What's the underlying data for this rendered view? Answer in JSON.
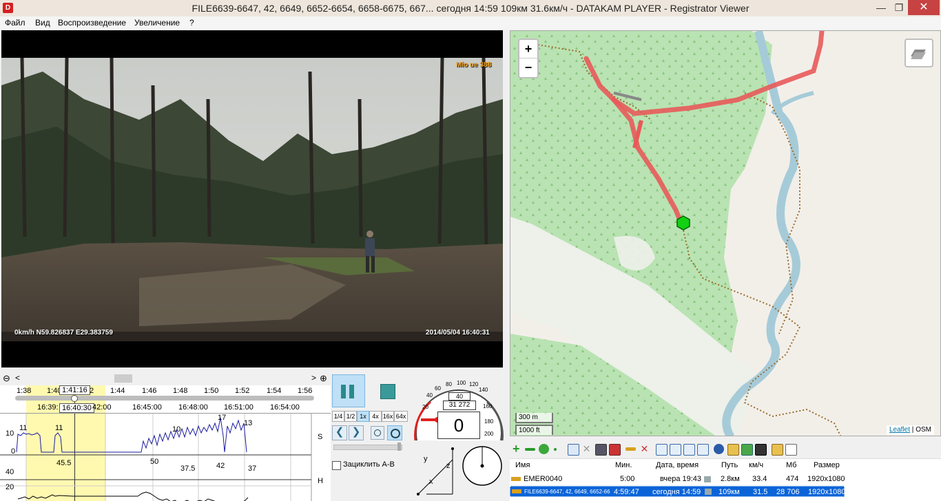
{
  "app": {
    "title": "FILE6639-6647, 42, 6649, 6652-6654, 6658-6675, 667...   сегодня 14:59    109км    31.6км/ч  -  DATAKAM PLAYER - Registrator Viewer",
    "icon": "D",
    "min_glyph": "—",
    "max_glyph": "❐",
    "close_glyph": "✕"
  },
  "menu": [
    "Файл",
    "Вид",
    "Воспроизведение",
    "Увеличение",
    "?"
  ],
  "video": {
    "osd_brand": "Mio ue 388",
    "osd_left": "0km/h N59.826837 E29.383759",
    "osd_right": "2014/05/04 16:40:31"
  },
  "timeline": {
    "zoom_out": "⊖",
    "zoom_in": "⊕",
    "nav_left": "<",
    "nav_right": ">",
    "top_ticks": [
      "1:38",
      "1:40",
      "2",
      "1:44",
      "1:46",
      "1:48",
      "1:50",
      "1:52",
      "1:54",
      "1:56"
    ],
    "cursor_top": "1:41:16",
    "cursor_bottom": "16:40:30",
    "bottom_ticks": [
      "16:39:",
      "42:00",
      "16:45:00",
      "16:48:00",
      "16:51:00",
      "16:54:00"
    ],
    "speed_label": "S",
    "height_label": "H",
    "speed_axis": [
      "10",
      "0"
    ],
    "height_axis": [
      "40",
      "20"
    ],
    "speed_values": [
      "11",
      "11",
      "10",
      "17",
      "13"
    ],
    "height_values": [
      "45.5",
      "50",
      "37.5",
      "42",
      "37"
    ]
  },
  "controls": {
    "rates": [
      "1/4",
      "1/2",
      "1x",
      "4x",
      "16x",
      "64x"
    ],
    "active_rate": "1x",
    "loop_label": "Зациклить A-B",
    "loop_checked": false
  },
  "gauge": {
    "ticks": [
      "20",
      "40",
      "60",
      "80",
      "100",
      "120",
      "140",
      "160",
      "180",
      "200"
    ],
    "speed_limit": "40",
    "odometer": "31 272",
    "speed": "0",
    "compass_labels": [
      "y",
      "z",
      "x"
    ]
  },
  "map": {
    "zoom_in": "+",
    "zoom_out": "−",
    "scale_m": "300 m",
    "scale_ft": "1000 ft",
    "attribution_link": "Leaflet",
    "attribution_sep": " | ",
    "attribution_osm": "OSM",
    "colors": {
      "route": "#e85a5a",
      "forest": "#b5e1b0",
      "river": "#a6cbd8",
      "path": "#9a6a2a",
      "marker": "#13d113"
    }
  },
  "files": {
    "headers": [
      "Имя",
      "Мин.",
      "Дата, время",
      "Путь",
      "км/ч",
      "Мб",
      "Размер"
    ],
    "rows": [
      {
        "name": "EMER0040",
        "min": "5:00",
        "date": "вчера 19:43",
        "path": "2.8км",
        "kmh": "33.4",
        "mb": "474",
        "size": "1920x1080",
        "selected": false
      },
      {
        "name": "FILE6639-6647, 42, 6649, 6652-66",
        "min": "4:59:47",
        "date": "сегодня 14:59",
        "path": "109км",
        "kmh": "31.5",
        "mb": "28 706",
        "size": "1920x1080",
        "selected": true
      }
    ]
  }
}
